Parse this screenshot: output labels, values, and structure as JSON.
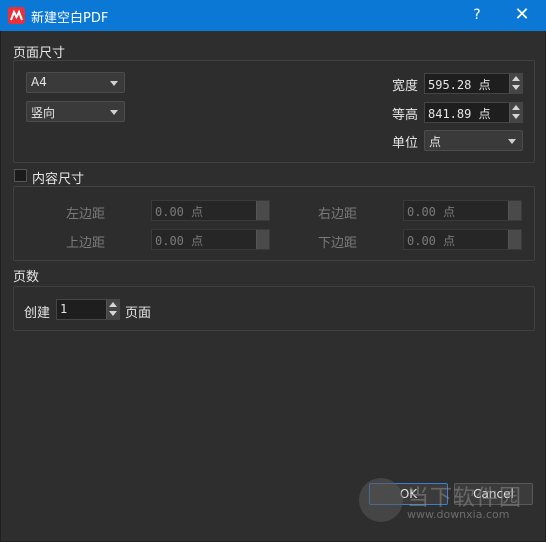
{
  "window": {
    "title": "新建空白PDF",
    "help_glyph": "?",
    "close_glyph": "✕"
  },
  "page_size": {
    "section_label": "页面尺寸",
    "paper_select": "A4",
    "orientation_select": "竖向",
    "width_label": "宽度",
    "width_value": "595.28 点",
    "height_label": "等高",
    "height_value": "841.89 点",
    "unit_label": "单位",
    "unit_select": "点"
  },
  "content_size": {
    "section_label": "内容尺寸",
    "checked": false,
    "left_label": "左边距",
    "left_value": "0.00 点",
    "right_label": "右边距",
    "right_value": "0.00 点",
    "top_label": "上边距",
    "top_value": "0.00 点",
    "bottom_label": "下边距",
    "bottom_value": "0.00 点"
  },
  "pages": {
    "section_label": "页数",
    "create_label": "创建",
    "count_value": "1",
    "suffix_label": "页面"
  },
  "buttons": {
    "ok_label": "OK",
    "cancel_label": "Cancel"
  },
  "watermark": {
    "main_text": "当下软件园",
    "url_text": "www.downxia.com"
  },
  "colors": {
    "titlebar": "#0b78d6",
    "background": "#2e2e2e",
    "app_icon": "#e8313a"
  }
}
